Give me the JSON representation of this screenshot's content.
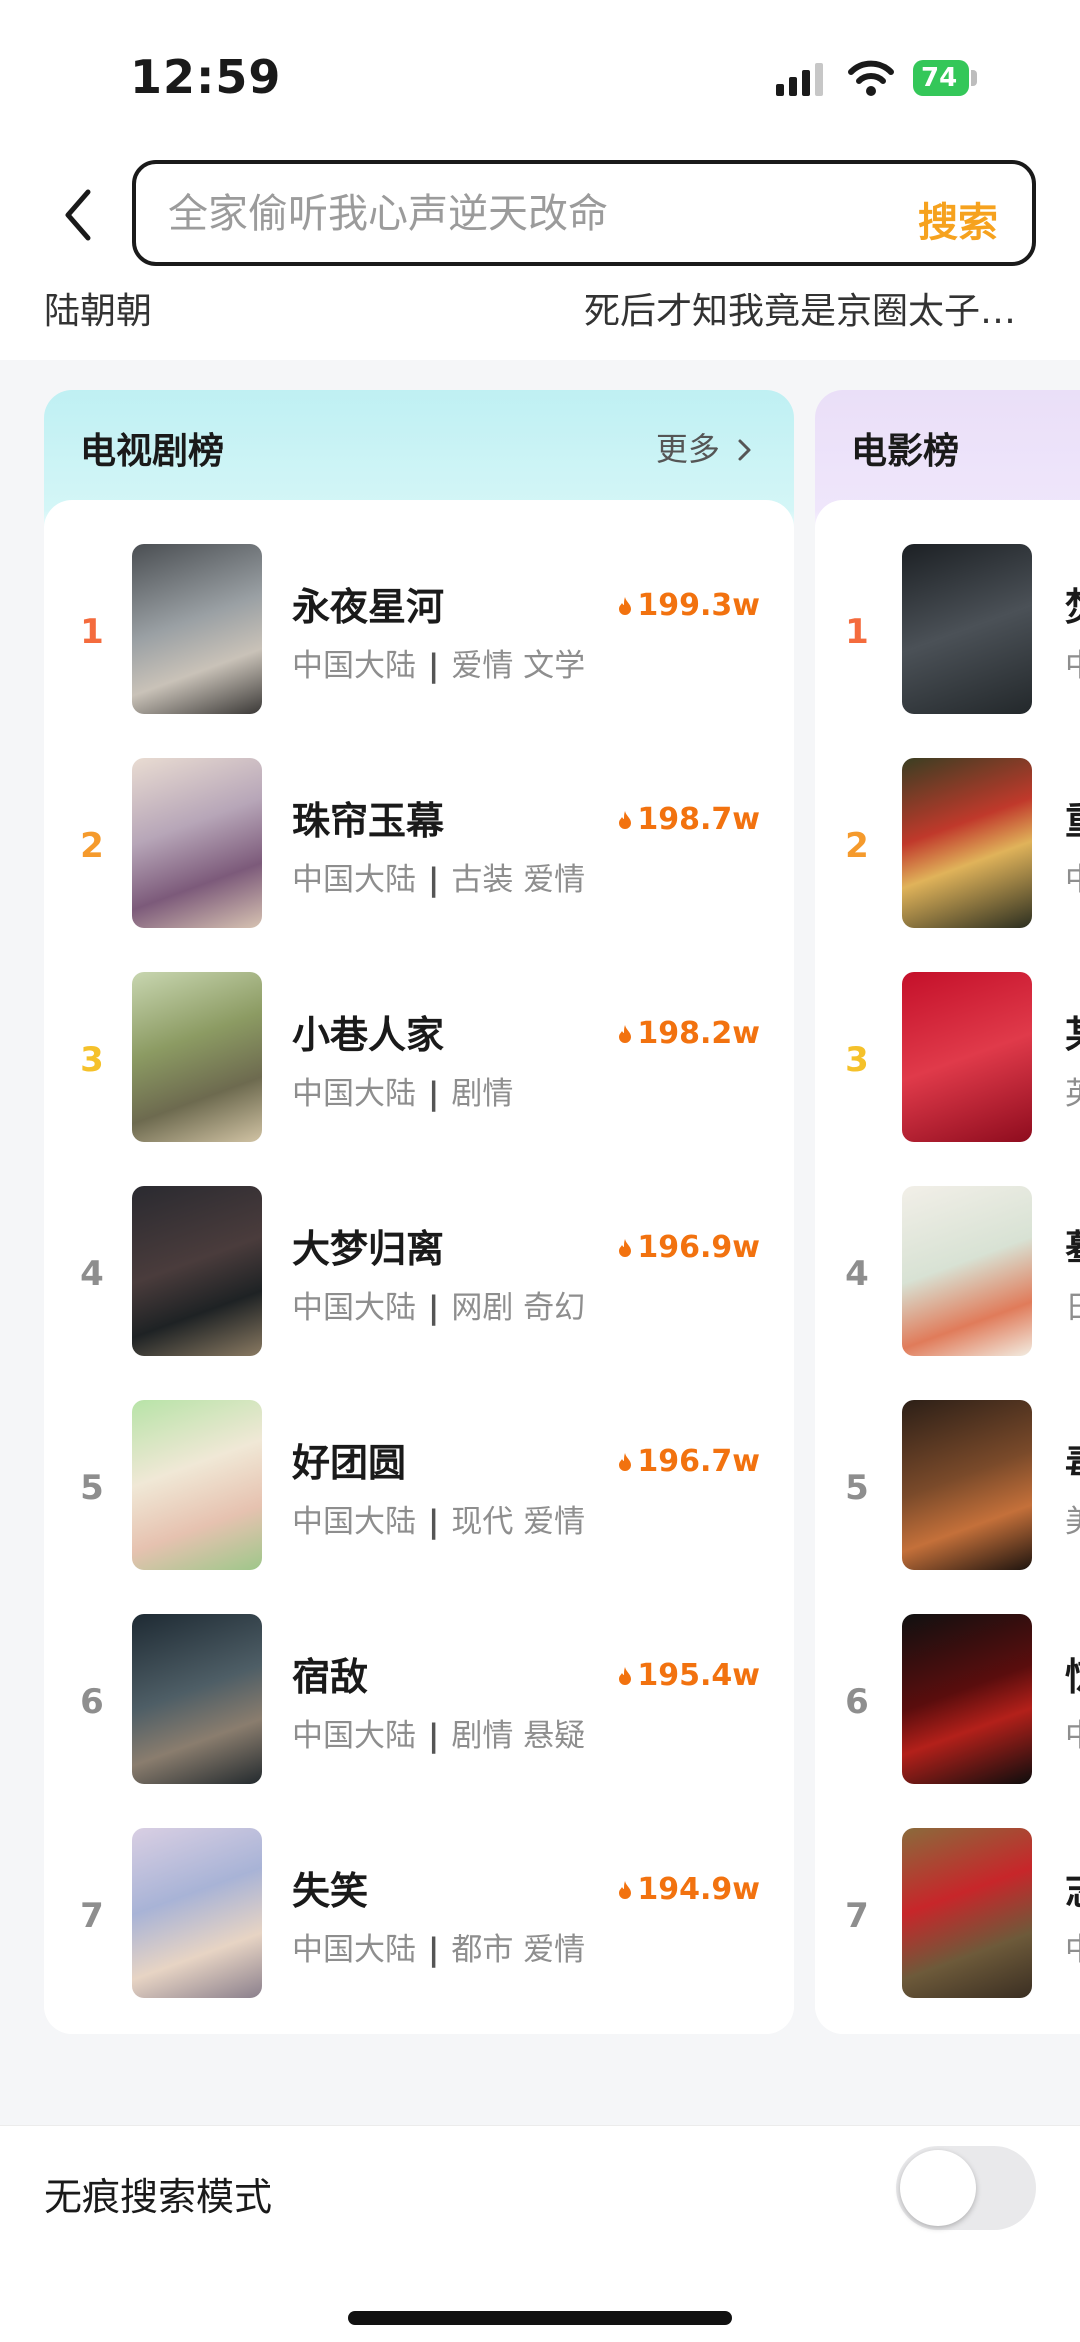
{
  "status_bar": {
    "time": "12:59",
    "battery": "74"
  },
  "search": {
    "placeholder": "全家偷听我心声逆天改命",
    "button": "搜索"
  },
  "hints": [
    "陆朝朝",
    "死后才知我竟是京圈太子…"
  ],
  "tv_chart": {
    "title": "电视剧榜",
    "more": "更多",
    "items": [
      {
        "rank": "1",
        "title": "永夜星河",
        "region": "中国大陆",
        "tags": "爱情 文学",
        "heat": "199.3w"
      },
      {
        "rank": "2",
        "title": "珠帘玉幕",
        "region": "中国大陆",
        "tags": "古装 爱情",
        "heat": "198.7w"
      },
      {
        "rank": "3",
        "title": "小巷人家",
        "region": "中国大陆",
        "tags": "剧情",
        "heat": "198.2w"
      },
      {
        "rank": "4",
        "title": "大梦归离",
        "region": "中国大陆",
        "tags": "网剧 奇幻",
        "heat": "196.9w"
      },
      {
        "rank": "5",
        "title": "好团圆",
        "region": "中国大陆",
        "tags": "现代 爱情",
        "heat": "196.7w"
      },
      {
        "rank": "6",
        "title": "宿敌",
        "region": "中国大陆",
        "tags": "剧情 悬疑",
        "heat": "195.4w"
      },
      {
        "rank": "7",
        "title": "失笑",
        "region": "中国大陆",
        "tags": "都市 爱情",
        "heat": "194.9w"
      }
    ]
  },
  "movie_chart": {
    "title": "电影榜",
    "items": [
      {
        "rank": "1",
        "title_partial": "焚",
        "meta_partial": "中"
      },
      {
        "rank": "2",
        "title_partial": "重",
        "meta_partial": "中"
      },
      {
        "rank": "3",
        "title_partial": "某",
        "meta_partial": "英"
      },
      {
        "rank": "4",
        "title_partial": "蓦",
        "meta_partial": "日"
      },
      {
        "rank": "5",
        "title_partial": "毒",
        "meta_partial": "美"
      },
      {
        "rank": "6",
        "title_partial": "惊",
        "meta_partial": "中"
      },
      {
        "rank": "7",
        "title_partial": "志",
        "meta_partial": "中"
      }
    ]
  },
  "incognito": {
    "label": "无痕搜索模式",
    "enabled": false
  }
}
